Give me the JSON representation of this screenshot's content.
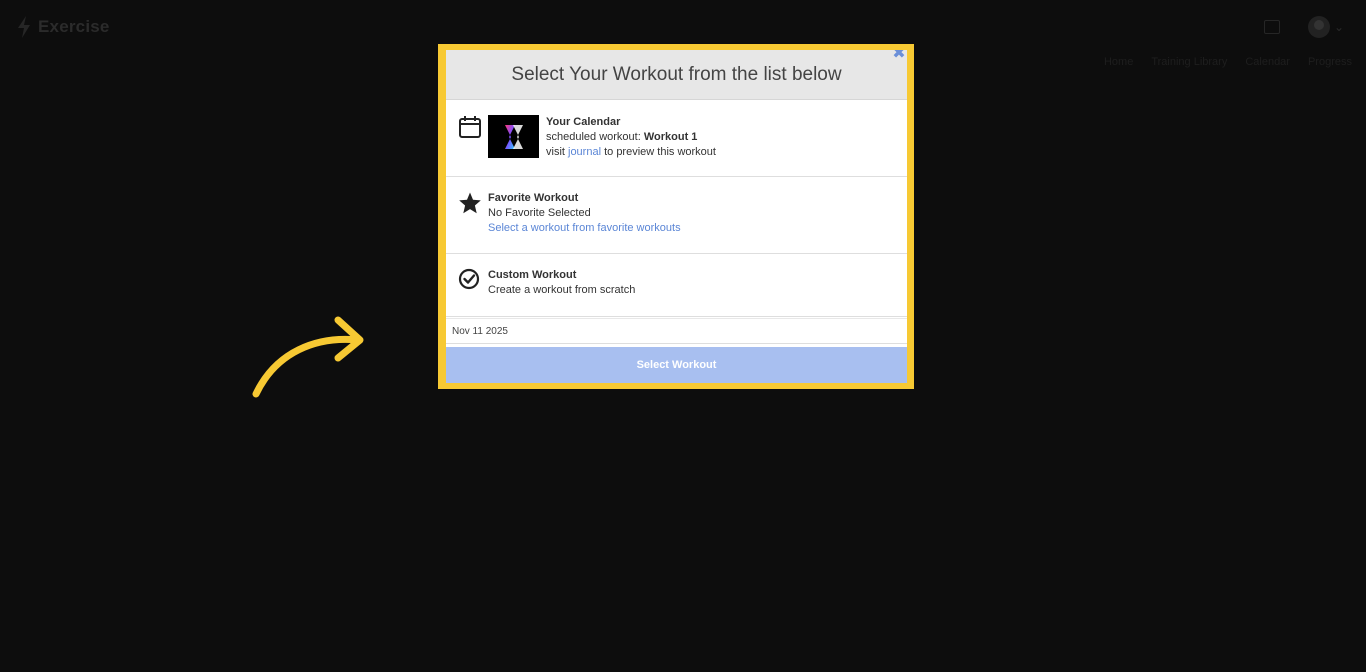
{
  "app": {
    "brand_name": "Exercise",
    "brand_icon": "bolt-logo-icon",
    "nav_items": [
      "Home",
      "Training Library",
      "Calendar",
      "Progress"
    ]
  },
  "modal": {
    "title": "Select Your Workout from the list below",
    "close_icon": "close-icon",
    "calendar_option": {
      "icon": "calendar-icon",
      "title": "Your Calendar",
      "scheduled_prefix": "scheduled workout: ",
      "scheduled_workout": "Workout 1",
      "visit_prefix": "visit ",
      "journal_link": "journal",
      "visit_suffix": " to preview this workout"
    },
    "favorite_option": {
      "icon": "star-icon",
      "title": "Favorite Workout",
      "status": "No Favorite Selected",
      "link": "Select a workout from favorite workouts"
    },
    "custom_option": {
      "icon": "check-circle-icon",
      "title": "Custom Workout",
      "description": "Create a workout from scratch"
    },
    "date": "Nov 11 2025",
    "select_button": "Select Workout"
  },
  "colors": {
    "highlight_frame": "#f7c933",
    "arrow": "#f7c933",
    "link": "#5b86d6",
    "button_disabled": "#a8bff0",
    "backdrop": "#0d0d0d"
  }
}
